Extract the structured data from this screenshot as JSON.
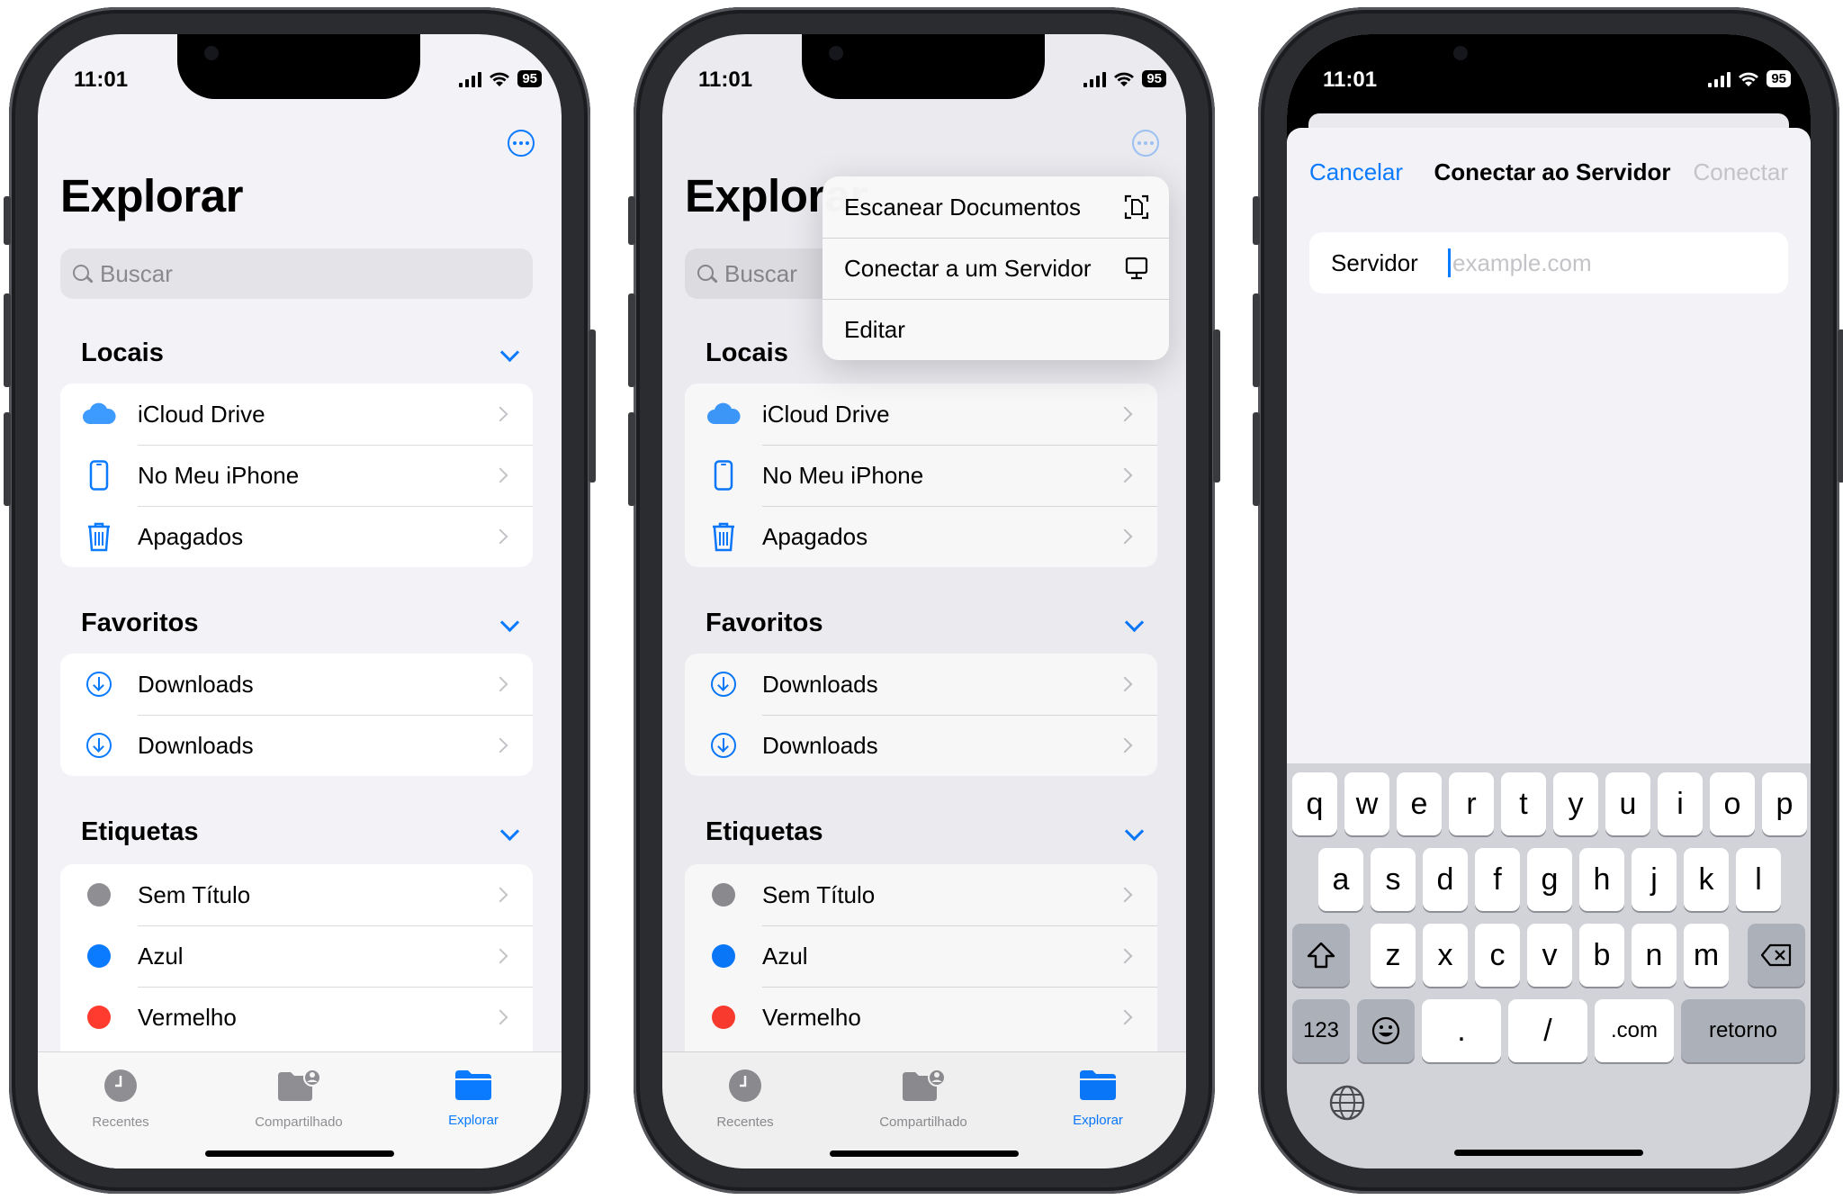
{
  "status": {
    "time": "11:01",
    "battery": "95"
  },
  "files": {
    "title": "Explorar",
    "search_placeholder": "Buscar",
    "sections": {
      "locais": {
        "title": "Locais",
        "items": [
          "iCloud Drive",
          "No Meu iPhone",
          "Apagados"
        ]
      },
      "favoritos": {
        "title": "Favoritos",
        "items": [
          "Downloads",
          "Downloads"
        ]
      },
      "etiquetas": {
        "title": "Etiquetas",
        "items": [
          "Sem Título",
          "Azul",
          "Vermelho"
        ]
      }
    },
    "tag_colors": [
      "#8e8e93",
      "#0a7aff",
      "#ff3b30"
    ],
    "tabs": [
      "Recentes",
      "Compartilhado",
      "Explorar"
    ],
    "active_tab": "Explorar"
  },
  "menu": {
    "items": [
      "Escanear Documentos",
      "Conectar a um Servidor",
      "Editar"
    ]
  },
  "connect": {
    "cancel": "Cancelar",
    "title": "Conectar ao Servidor",
    "connect": "Conectar",
    "field_label": "Servidor",
    "field_placeholder": "example.com"
  },
  "keyboard": {
    "row1": [
      "q",
      "w",
      "e",
      "r",
      "t",
      "y",
      "u",
      "i",
      "o",
      "p"
    ],
    "row2": [
      "a",
      "s",
      "d",
      "f",
      "g",
      "h",
      "j",
      "k",
      "l"
    ],
    "row3": [
      "z",
      "x",
      "c",
      "v",
      "b",
      "n",
      "m"
    ],
    "numbers": "123",
    "dot": ".",
    "slash": "/",
    "dotcom": ".com",
    "return": "retorno"
  },
  "colors": {
    "accent": "#0a7aff",
    "background": "#f2f2f7"
  }
}
